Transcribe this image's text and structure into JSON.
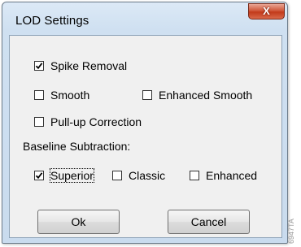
{
  "window": {
    "title": "LOD Settings",
    "close_glyph": "X"
  },
  "options": {
    "spike_removal": {
      "label": "Spike Removal",
      "checked": true
    },
    "smooth": {
      "label": "Smooth",
      "checked": false
    },
    "enhanced_smooth": {
      "label": "Enhanced Smooth",
      "checked": false
    },
    "pullup_correction": {
      "label": "Pull-up Correction",
      "checked": false
    }
  },
  "baseline": {
    "heading": "Baseline Subtraction:",
    "superior": {
      "label": "Superior",
      "checked": true
    },
    "classic": {
      "label": "Classic",
      "checked": false
    },
    "enhanced": {
      "label": "Enhanced",
      "checked": false
    }
  },
  "buttons": {
    "ok": "Ok",
    "cancel": "Cancel"
  },
  "watermark": "6947TA"
}
